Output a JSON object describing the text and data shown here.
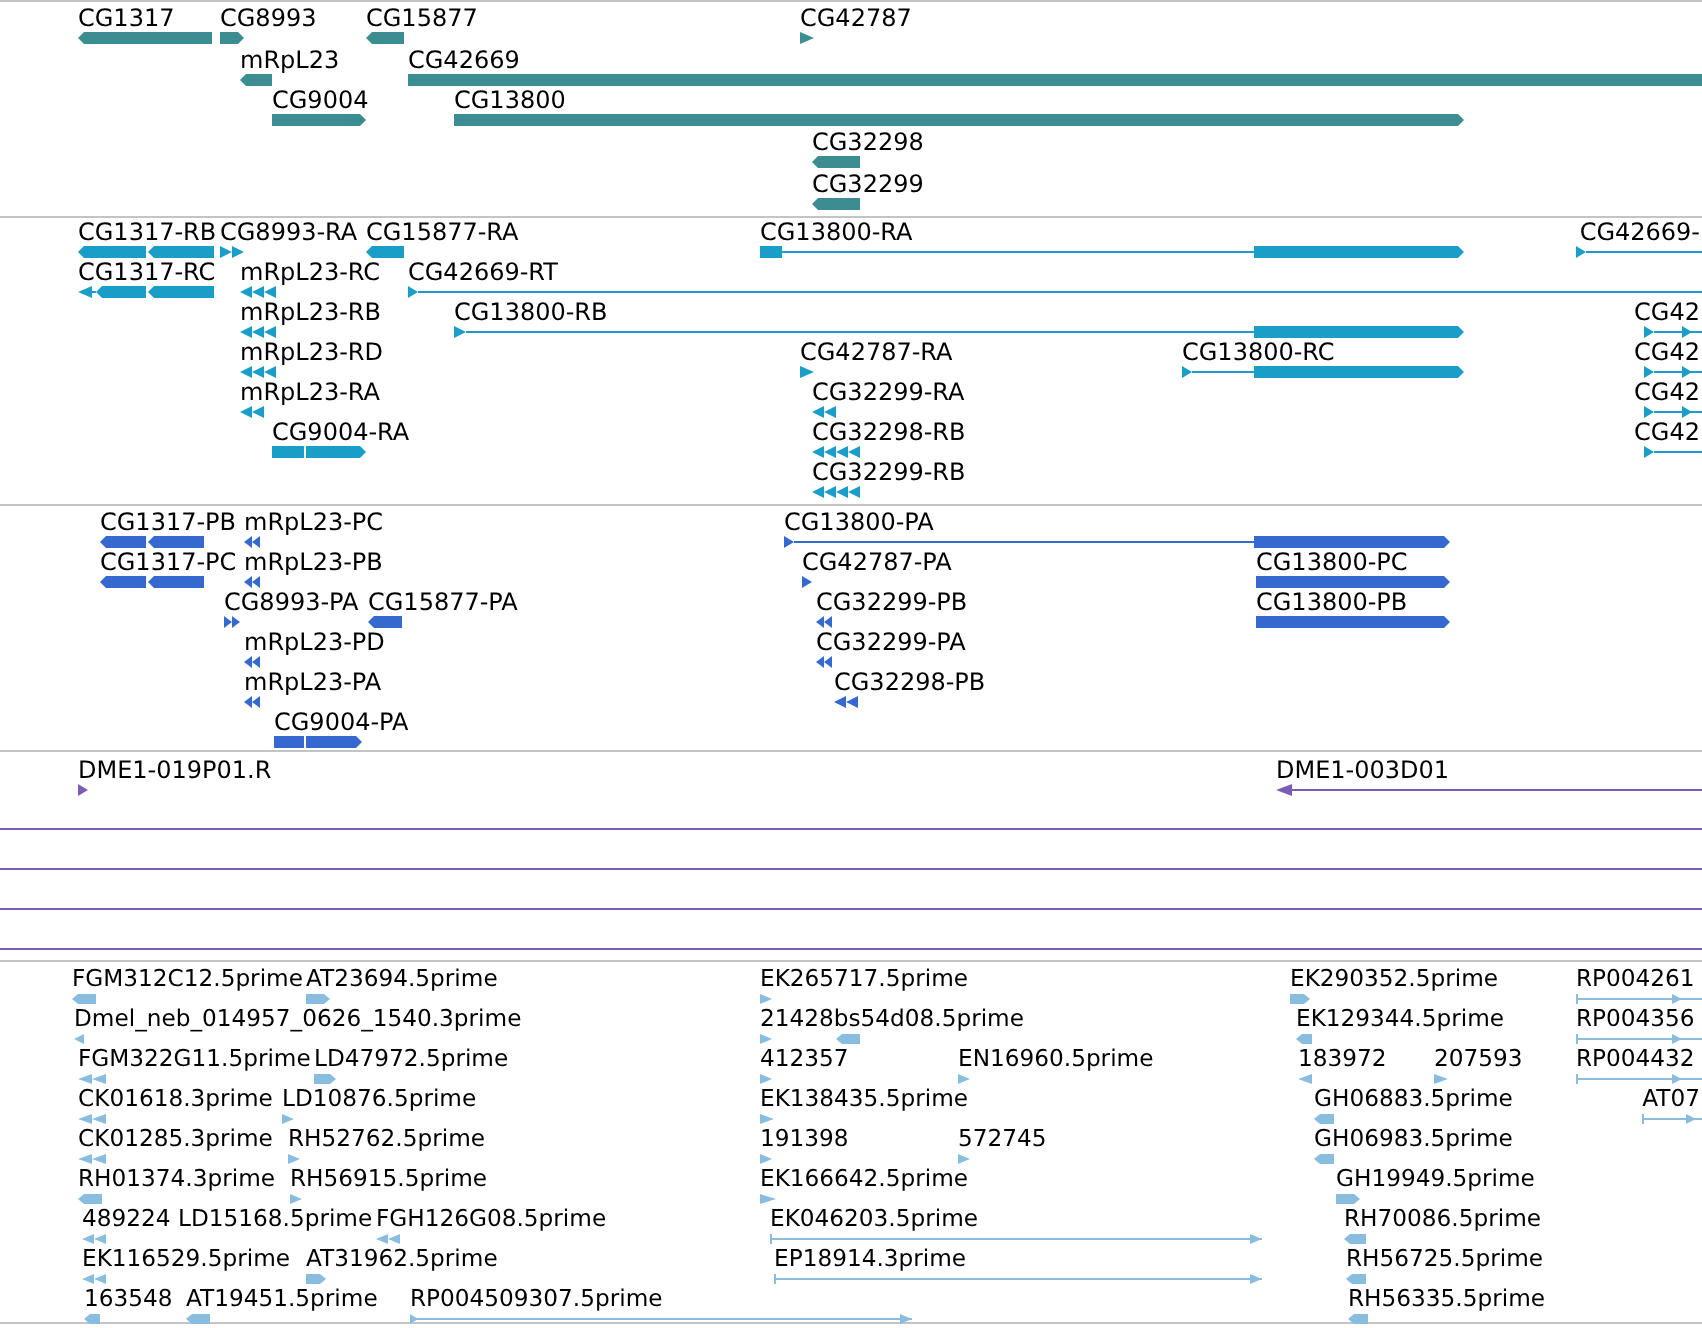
{
  "tracks": [
    {
      "kind": "gene",
      "features": [
        {
          "label": "CG1317",
          "reverse": true
        },
        {
          "label": "CG8993",
          "reverse": false
        },
        {
          "label": "CG15877",
          "reverse": true
        },
        {
          "label": "CG42787",
          "reverse": false
        },
        {
          "label": "mRpL23",
          "reverse": true
        },
        {
          "label": "CG42669"
        },
        {
          "label": "CG9004",
          "reverse": false
        },
        {
          "label": "CG13800",
          "reverse": false
        },
        {
          "label": "CG32298",
          "reverse": true
        },
        {
          "label": "CG32299",
          "reverse": true
        }
      ]
    },
    {
      "kind": "transcript",
      "features": [
        {
          "label": "CG1317-RB",
          "reverse": true
        },
        {
          "label": "CG8993-RA",
          "reverse": false
        },
        {
          "label": "CG15877-RA",
          "reverse": true
        },
        {
          "label": "CG13800-RA",
          "reverse": false
        },
        {
          "label": "CG42669-",
          "reverse": false
        },
        {
          "label": "CG1317-RC",
          "reverse": true
        },
        {
          "label": "mRpL23-RC",
          "reverse": true
        },
        {
          "label": "CG42669-RT",
          "reverse": false
        },
        {
          "label": "mRpL23-RB",
          "reverse": true
        },
        {
          "label": "CG13800-RB",
          "reverse": false
        },
        {
          "label": "CG42",
          "reverse": false
        },
        {
          "label": "mRpL23-RD",
          "reverse": true
        },
        {
          "label": "CG42787-RA",
          "reverse": false
        },
        {
          "label": "CG13800-RC",
          "reverse": false
        },
        {
          "label": "CG42",
          "reverse": false
        },
        {
          "label": "mRpL23-RA",
          "reverse": true
        },
        {
          "label": "CG32299-RA",
          "reverse": true
        },
        {
          "label": "CG42",
          "reverse": false
        },
        {
          "label": "CG9004-RA",
          "reverse": false
        },
        {
          "label": "CG32298-RB",
          "reverse": true
        },
        {
          "label": "CG42",
          "reverse": false
        },
        {
          "label": "CG32299-RB",
          "reverse": true
        }
      ]
    },
    {
      "kind": "protein",
      "features": [
        {
          "label": "CG1317-PB",
          "reverse": true
        },
        {
          "label": "mRpL23-PC",
          "reverse": true
        },
        {
          "label": "CG13800-PA",
          "reverse": false
        },
        {
          "label": "CG1317-PC",
          "reverse": true
        },
        {
          "label": "mRpL23-PB",
          "reverse": true
        },
        {
          "label": "CG42787-PA",
          "reverse": false
        },
        {
          "label": "CG13800-PC",
          "reverse": false
        },
        {
          "label": "CG8993-PA",
          "reverse": false
        },
        {
          "label": "CG15877-PA",
          "reverse": true
        },
        {
          "label": "CG32299-PB",
          "reverse": true
        },
        {
          "label": "CG13800-PB",
          "reverse": false
        },
        {
          "label": "mRpL23-PD",
          "reverse": true
        },
        {
          "label": "CG32299-PA",
          "reverse": true
        },
        {
          "label": "mRpL23-PA",
          "reverse": true
        },
        {
          "label": "CG32298-PB",
          "reverse": true
        },
        {
          "label": "CG9004-PA",
          "reverse": false
        }
      ]
    },
    {
      "kind": "clone",
      "features": [
        {
          "label": "DME1-019P01.R",
          "reverse": false
        },
        {
          "label": "DME1-003D01",
          "reverse": true
        }
      ]
    },
    {
      "kind": "est",
      "features": [
        {
          "label": "FGM312C12.5prime",
          "reverse": true
        },
        {
          "label": "AT23694.5prime",
          "reverse": false
        },
        {
          "label": "EK265717.5prime",
          "reverse": false
        },
        {
          "label": "EK290352.5prime",
          "reverse": false
        },
        {
          "label": "RP004261",
          "reverse": false
        },
        {
          "label": "Dmel_neb_014957_0626_1540.3prime",
          "reverse": true
        },
        {
          "label": "21428bs54d08.5prime",
          "reverse": false
        },
        {
          "reverse": true
        },
        {
          "label": "EK129344.5prime",
          "reverse": true
        },
        {
          "label": "RP004356",
          "reverse": false
        },
        {
          "label": "FGM322G11.5prime",
          "reverse": true
        },
        {
          "label": "LD47972.5prime",
          "reverse": false
        },
        {
          "label": "412357",
          "reverse": false
        },
        {
          "label": "EN16960.5prime",
          "reverse": false
        },
        {
          "label": "183972",
          "reverse": true
        },
        {
          "label": "207593",
          "reverse": false
        },
        {
          "label": "RP004432",
          "reverse": false
        },
        {
          "label": "CK01618.3prime",
          "reverse": true
        },
        {
          "label": "LD10876.5prime",
          "reverse": false
        },
        {
          "label": "EK138435.5prime",
          "reverse": false
        },
        {
          "label": "GH06883.5prime",
          "reverse": true
        },
        {
          "label": "AT07",
          "reverse": false
        },
        {
          "label": "CK01285.3prime",
          "reverse": true
        },
        {
          "label": "RH52762.5prime",
          "reverse": false
        },
        {
          "label": "191398",
          "reverse": false
        },
        {
          "label": "572745",
          "reverse": false
        },
        {
          "label": "GH06983.5prime",
          "reverse": true
        },
        {
          "label": "RH01374.3prime",
          "reverse": true
        },
        {
          "label": "RH56915.5prime",
          "reverse": false
        },
        {
          "label": "EK166642.5prime",
          "reverse": false
        },
        {
          "label": "GH19949.5prime",
          "reverse": false
        },
        {
          "label": "489224",
          "reverse": true
        },
        {
          "label": "LD15168.5prime"
        },
        {
          "label": "FGH126G08.5prime",
          "reverse": true
        },
        {
          "label": "EK046203.5prime",
          "reverse": false
        },
        {
          "label": "RH70086.5prime",
          "reverse": true
        },
        {
          "label": "EK116529.5prime",
          "reverse": true
        },
        {
          "label": "AT31962.5prime",
          "reverse": false
        },
        {
          "label": "EP18914.3prime",
          "reverse": false
        },
        {
          "label": "RH56725.5prime",
          "reverse": true
        },
        {
          "label": "163548",
          "reverse": true
        },
        {
          "label": "AT19451.5prime",
          "reverse": true
        },
        {
          "label": "RP004509307.5prime",
          "reverse": false
        },
        {
          "label": "RH56335.5prime",
          "reverse": true
        }
      ]
    }
  ]
}
